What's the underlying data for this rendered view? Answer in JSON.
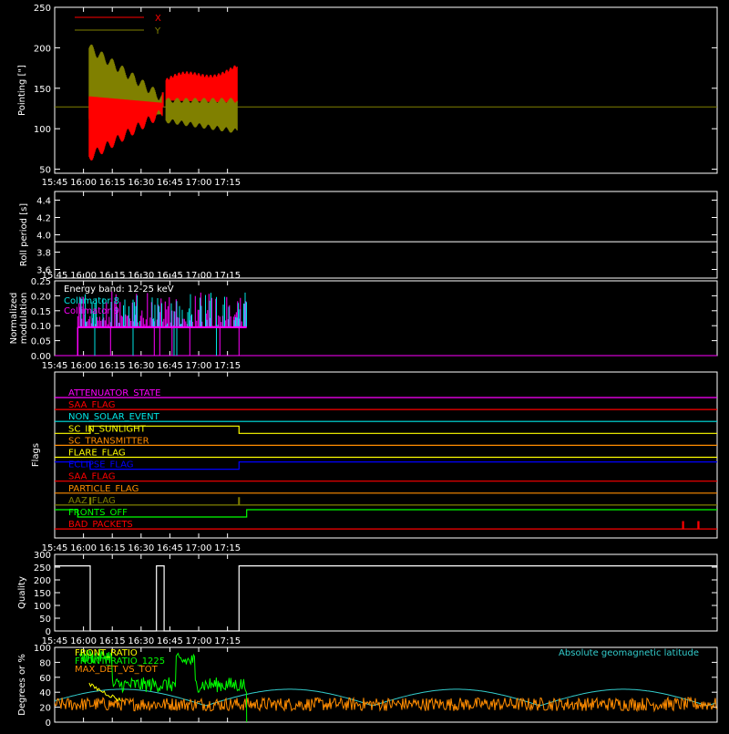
{
  "colors": {
    "background": "#000000",
    "axis": "#ffffff",
    "pointing_x": "#ff0000",
    "pointing_y": "#808000",
    "collimator_8": "#00e5e5",
    "collimator_9": "#ff00ff",
    "front_ratio": "#ffff00",
    "front_ratio_1225": "#00ff00",
    "max_det": "#ff8c00",
    "geomag": "#33cccc"
  },
  "time_axis": {
    "range_min": [
      945,
      1290
    ],
    "tick_minutes": [
      945,
      960,
      975,
      990,
      1005,
      1020,
      1035
    ],
    "tick_labels": [
      "15:45",
      "16:00",
      "16:15",
      "16:30",
      "16:45",
      "17:00",
      "17:15"
    ]
  },
  "chart_data": [
    {
      "id": "pointing",
      "type": "line",
      "ylabel": "Pointing [\"]",
      "ylim": [
        45,
        250
      ],
      "yticks": [
        50,
        100,
        150,
        200,
        250
      ],
      "legend": [
        {
          "name": "X",
          "color": "#ff0000"
        },
        {
          "name": "Y",
          "color": "#808000"
        }
      ],
      "baseline": 127,
      "segments": [
        {
          "t_start": 963,
          "t_end": 1001,
          "x_min_start": 65,
          "x_min_end": 120,
          "y_max_start": 200,
          "y_max_end": 138
        },
        {
          "t_start": 1003,
          "t_end": 1040,
          "x_max_start": 160,
          "x_max_end": 175,
          "x_min_start": 135,
          "x_min_end": 132,
          "y_max_start": 135,
          "y_max_end": 135,
          "y_min_start": 110,
          "y_min_end": 97
        }
      ]
    },
    {
      "id": "roll-period",
      "type": "line",
      "ylabel": "Roll period [s]",
      "ylim": [
        3.5,
        4.5
      ],
      "yticks": [
        3.6,
        3.8,
        4.0,
        4.2,
        4.4
      ],
      "ytick_labels": [
        "3.6",
        "3.8",
        "4.0",
        "4.2",
        "4.4"
      ],
      "value": 3.92
    },
    {
      "id": "modulation",
      "type": "line",
      "ylabel": "Normalized modulation",
      "ylim": [
        0,
        0.25
      ],
      "yticks": [
        0,
        0.05,
        0.1,
        0.15,
        0.2,
        0.25
      ],
      "ytick_labels": [
        "0.00",
        "0.05",
        "0.10",
        "0.15",
        "0.20",
        "0.25"
      ],
      "annotation": "Energy band: 12-25 keV",
      "legend": [
        {
          "name": "Collimator 8",
          "color": "#00e5e5"
        },
        {
          "name": "Collimator 9",
          "color": "#ff00ff"
        }
      ],
      "t_start": 957,
      "t_end": 1045,
      "baseline": 0.095
    },
    {
      "id": "flags",
      "type": "line",
      "ylabel": "Flags",
      "flags": [
        {
          "name": "ATTENUATOR_STATE",
          "color": "#ff00ff",
          "steps": []
        },
        {
          "name": "SAA_FLAG",
          "color": "#ff0000",
          "steps": []
        },
        {
          "name": "NON_SOLAR_EVENT",
          "color": "#00e5e5",
          "steps": []
        },
        {
          "name": "SC_IN_SUNLIGHT",
          "color": "#ffff00",
          "steps": [
            [
              945,
              0
            ],
            [
              963.5,
              1
            ],
            [
              1041,
              0
            ]
          ]
        },
        {
          "name": "SC_TRANSMITTER",
          "color": "#ff8c00",
          "steps": []
        },
        {
          "name": "FLARE_FLAG",
          "color": "#ffff00",
          "steps": []
        },
        {
          "name": "ECLIPSE_FLAG",
          "color": "#0000ff",
          "steps": [
            [
              945,
              1
            ],
            [
              963.5,
              0
            ],
            [
              1041,
              1
            ]
          ]
        },
        {
          "name": "SAA_FLAG",
          "color": "#ff0000",
          "steps": []
        },
        {
          "name": "PARTICLE_FLAG",
          "color": "#ff8c00",
          "steps": []
        },
        {
          "name": "AAZ_FLAG",
          "color": "#808000",
          "steps": [
            [
              945,
              0
            ],
            [
              963.3,
              1
            ],
            [
              963.8,
              0
            ],
            [
              1040.8,
              1
            ],
            [
              1041.2,
              0
            ]
          ]
        },
        {
          "name": "FRONTS_OFF",
          "color": "#00ff00",
          "steps": [
            [
              945,
              1
            ],
            [
              957,
              0
            ],
            [
              1045,
              1
            ]
          ]
        },
        {
          "name": "BAD_PACKETS",
          "color": "#ff0000",
          "steps": [
            [
              945,
              0
            ],
            [
              1272,
              1
            ],
            [
              1272.5,
              0
            ],
            [
              1280,
              1
            ],
            [
              1280.5,
              0
            ]
          ]
        }
      ]
    },
    {
      "id": "quality",
      "type": "line",
      "ylabel": "Quality",
      "ylim": [
        0,
        300
      ],
      "yticks": [
        0,
        50,
        100,
        150,
        200,
        250,
        300
      ],
      "steps": [
        [
          945,
          255
        ],
        [
          963.5,
          0
        ],
        [
          998,
          255
        ],
        [
          1002,
          0
        ],
        [
          1041,
          255
        ],
        [
          1290,
          255
        ]
      ]
    },
    {
      "id": "ratios",
      "type": "line",
      "ylabel": "Degrees or %",
      "ylim": [
        0,
        100
      ],
      "yticks": [
        0,
        20,
        40,
        60,
        80,
        100
      ],
      "legend": [
        {
          "name": "FRONT_RATIO",
          "color": "#ffff00"
        },
        {
          "name": "FRONT_RATIO_1225",
          "color": "#00ff00"
        },
        {
          "name": "MAX_DET_VS_TOT",
          "color": "#ff8c00"
        }
      ],
      "annotation": "Absolute geomagnetic latitude",
      "front_ratio_1225_levels": [
        [
          958,
          88
        ],
        [
          975,
          50
        ],
        [
          990,
          50
        ],
        [
          1008,
          82
        ],
        [
          1018,
          50
        ],
        [
          1030,
          50
        ]
      ]
    }
  ]
}
